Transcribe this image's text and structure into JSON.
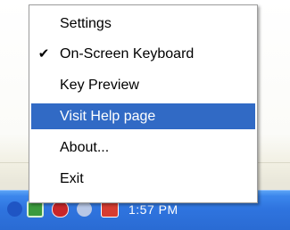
{
  "system_tray": {
    "clock": "1:57 PM",
    "icons": [
      "network-icon",
      "security-center-icon",
      "shield-icon",
      "connection-icon",
      "app-tray-icon"
    ]
  },
  "context_menu": {
    "highlight_color": "#316ac5",
    "items": [
      {
        "label": "Settings",
        "checked": false,
        "highlighted": false
      },
      {
        "label": "On-Screen Keyboard",
        "checked": true,
        "highlighted": false
      },
      {
        "label": "Key Preview",
        "checked": false,
        "highlighted": false
      },
      {
        "label": "Visit Help page",
        "checked": false,
        "highlighted": true
      },
      {
        "label": "About...",
        "checked": false,
        "highlighted": false
      },
      {
        "label": "Exit",
        "checked": false,
        "highlighted": false
      }
    ]
  }
}
